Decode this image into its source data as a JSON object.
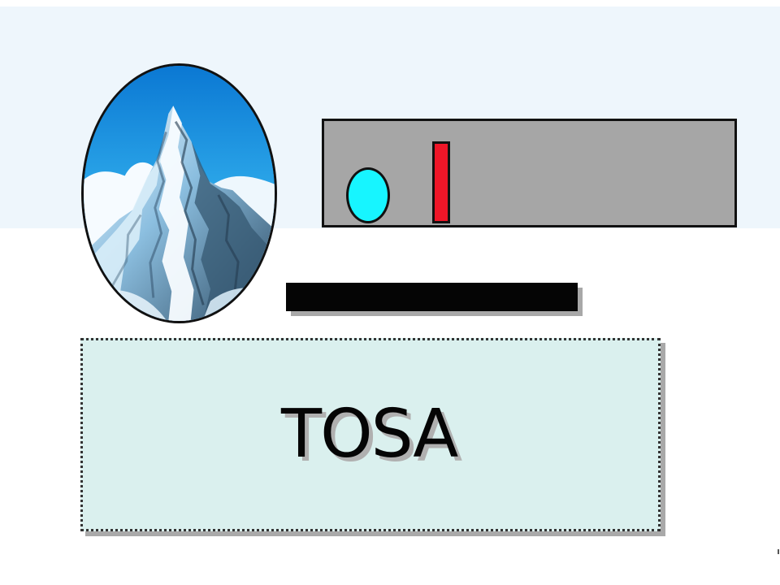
{
  "slide": {
    "main_label": "TOSA"
  },
  "colors": {
    "top_band": "#eef6fc",
    "panel": "#a6a6a6",
    "cyan_shape": "#17f5ff",
    "red_shape": "#ef1628",
    "black_bar": "#050505",
    "label_box": "#daf0ee"
  },
  "icons": {
    "image": "mountain-photo"
  }
}
